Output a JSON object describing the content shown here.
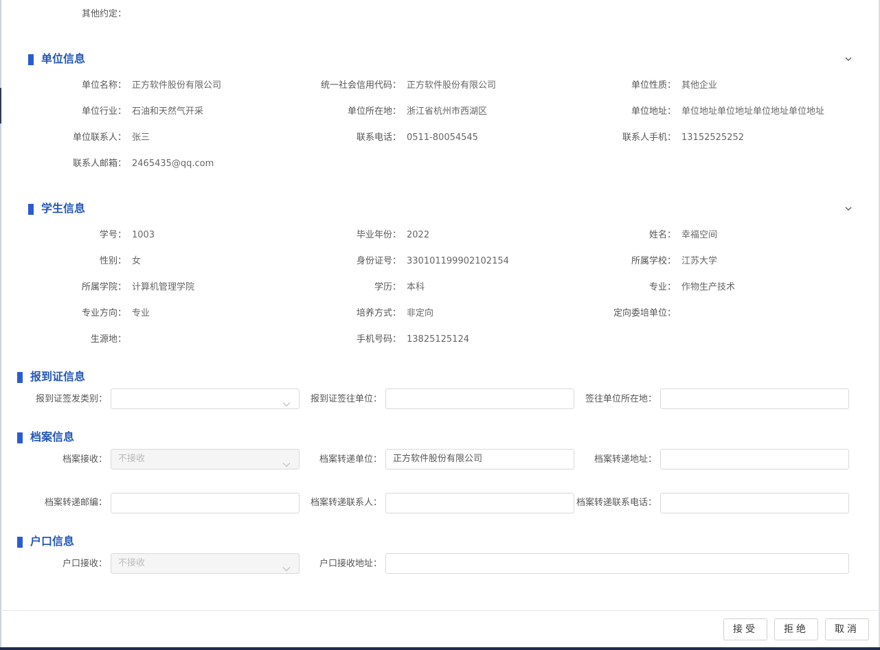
{
  "top": {
    "other_label": "其他约定：",
    "other_value": ""
  },
  "unit": {
    "title": "单位信息",
    "rows": [
      [
        "单位名称：",
        "正方软件股份有限公司",
        "统一社会信用代码：",
        "正方软件股份有限公司",
        "单位性质：",
        "其他企业"
      ],
      [
        "单位行业：",
        "石油和天然气开采",
        "单位所在地：",
        "浙江省杭州市西湖区",
        "单位地址：",
        "单位地址单位地址单位地址单位地址"
      ],
      [
        "单位联系人：",
        "张三",
        "联系电话：",
        "0511-80054545",
        "联系人手机：",
        "13152525252"
      ],
      [
        "联系人邮箱：",
        "2465435@qq.com"
      ]
    ]
  },
  "student": {
    "title": "学生信息",
    "rows": [
      [
        "学号：",
        "1003",
        "毕业年份：",
        "2022",
        "姓名：",
        "幸福空间"
      ],
      [
        "性别：",
        "女",
        "身份证号：",
        "330101199902102154",
        "所属学校：",
        "江苏大学"
      ],
      [
        "所属学院：",
        "计算机管理学院",
        "学历：",
        "本科",
        "专业：",
        "作物生产技术"
      ],
      [
        "专业方向：",
        "专业",
        "培养方式：",
        "非定向",
        "定向委培单位：",
        ""
      ],
      [
        "生源地：",
        "",
        "手机号码：",
        "13825125124"
      ]
    ]
  },
  "report": {
    "title": "报到证信息",
    "type_label": "报到证签发类别：",
    "type_value": "",
    "unit_label": "报到证签往单位：",
    "unit_value": "",
    "loc_label": "签往单位所在地：",
    "loc_value": ""
  },
  "archive": {
    "title": "档案信息",
    "receive_label": "档案接收：",
    "receive_value": "不接收",
    "unit_label": "档案转递单位：",
    "unit_value": "正方软件股份有限公司",
    "addr_label": "档案转递地址：",
    "addr_value": "",
    "zip_label": "档案转递邮编：",
    "zip_value": "",
    "contact_label": "档案转递联系人：",
    "contact_value": "",
    "phone_label": "档案转递联系电话：",
    "phone_value": ""
  },
  "hukou": {
    "title": "户口信息",
    "receive_label": "户口接收：",
    "receive_value": "不接收",
    "addr_label": "户口接收地址：",
    "addr_value": ""
  },
  "buttons": {
    "accept": "接受",
    "reject": "拒绝",
    "cancel": "取消"
  },
  "colors": {
    "accent": "#2a5bd0",
    "title": "#2557b8"
  }
}
